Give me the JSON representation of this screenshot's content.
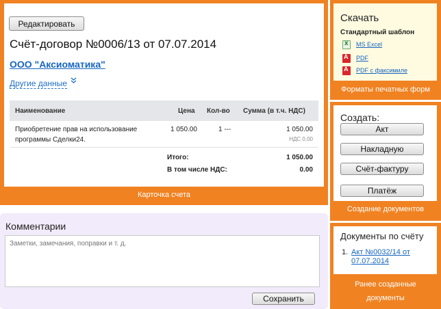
{
  "invoice_card": {
    "edit_button": "Редактировать",
    "title": "Счёт-договор №0006/13 от 07.07.2014",
    "company": "ООО \"Аксиоматика\"",
    "other_data": "Другие данные",
    "other_data_icon": "double-chevron-down-icon",
    "table": {
      "headers": [
        "Наименование",
        "Цена",
        "Кол-во",
        "Сумма (в т.ч. НДС)"
      ],
      "rows": [
        {
          "name_line1": "Приобретение прав на использование",
          "name_line2": "программы Сделки24.",
          "price": "1 050.00",
          "qty": "1 ---",
          "sum": "1 050.00",
          "vat_note": "НДС 0.00"
        }
      ]
    },
    "totals": {
      "total_label": "Итого:",
      "total_value": "1 050.00",
      "vat_label": "В том числе НДС:",
      "vat_value": "0.00"
    },
    "caption": "Карточка счета"
  },
  "download_panel": {
    "title": "Скачать",
    "subtitle": "Стандартный шаблон",
    "links": [
      {
        "label": "MS Excel",
        "icon": "excel-icon"
      },
      {
        "label": "PDF",
        "icon": "pdf-icon"
      },
      {
        "label": "PDF с факсимиле",
        "icon": "pdf-icon"
      }
    ],
    "caption": "Форматы печатных форм"
  },
  "create_panel": {
    "title": "Создать:",
    "buttons": [
      "Акт",
      "Накладную",
      "Счёт-фактуру",
      "Платёж"
    ],
    "caption": "Создание документов"
  },
  "comments": {
    "title": "Комментарии",
    "placeholder": "Заметки, замечания, поправки и т. д.",
    "save_button": "Сохранить"
  },
  "related_docs": {
    "title": "Документы по счёту",
    "items": [
      {
        "num": "1.",
        "label": "Акт №0032/14 от 07.07.2014"
      }
    ],
    "caption_line1": "Ранее созданные",
    "caption_line2": "документы"
  },
  "colors": {
    "accent_orange": "#f08222",
    "link_blue": "#1565c0",
    "download_bg": "#fffbe0",
    "comments_bg": "#f1ebfb"
  }
}
